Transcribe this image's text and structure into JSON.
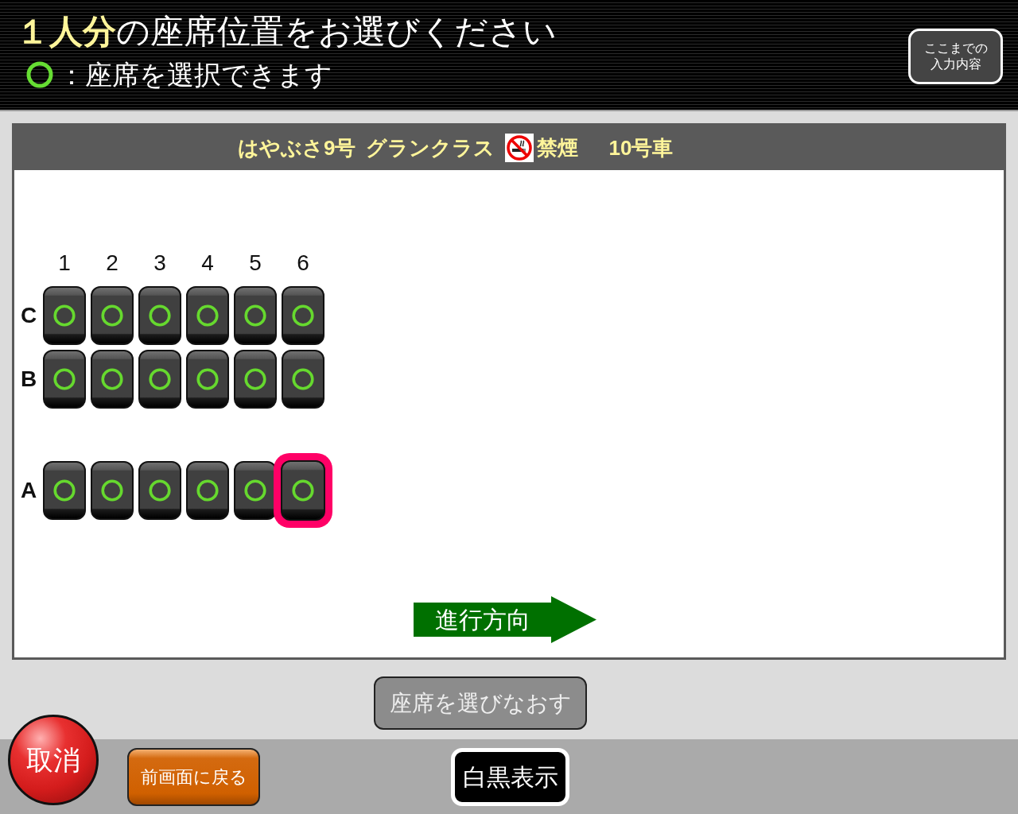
{
  "header": {
    "title": "**１人分**の座席位置をお選びください",
    "legend": "：座席を選択できます",
    "summary_button": "ここまでの入力内容"
  },
  "car_bar": {
    "train": "はやぶさ9号",
    "class": "グランクラス",
    "smoking": "禁煙",
    "car": "10号車"
  },
  "seat_map": {
    "columns": [
      "1",
      "2",
      "3",
      "4",
      "5",
      "6"
    ],
    "rows": [
      {
        "kind": "seats",
        "label": "C",
        "seats": [
          {
            "available": true,
            "selected": false
          },
          {
            "available": true,
            "selected": false
          },
          {
            "available": true,
            "selected": false
          },
          {
            "available": true,
            "selected": false
          },
          {
            "available": true,
            "selected": false
          },
          {
            "available": true,
            "selected": false
          }
        ]
      },
      {
        "kind": "seats",
        "label": "B",
        "seats": [
          {
            "available": true,
            "selected": false
          },
          {
            "available": true,
            "selected": false
          },
          {
            "available": true,
            "selected": false
          },
          {
            "available": true,
            "selected": false
          },
          {
            "available": true,
            "selected": false
          },
          {
            "available": true,
            "selected": false
          }
        ]
      },
      {
        "kind": "aisle"
      },
      {
        "kind": "seats",
        "label": "A",
        "seats": [
          {
            "available": true,
            "selected": false
          },
          {
            "available": true,
            "selected": false
          },
          {
            "available": true,
            "selected": false
          },
          {
            "available": true,
            "selected": false
          },
          {
            "available": true,
            "selected": false
          },
          {
            "available": true,
            "selected": true
          }
        ]
      }
    ]
  },
  "direction": "進行方向",
  "reselect_button": "座席を選びなおす",
  "footer": {
    "cancel_button": "取消",
    "back_button": "前画面に戻る",
    "monochrome_button": "白黒表示"
  }
}
